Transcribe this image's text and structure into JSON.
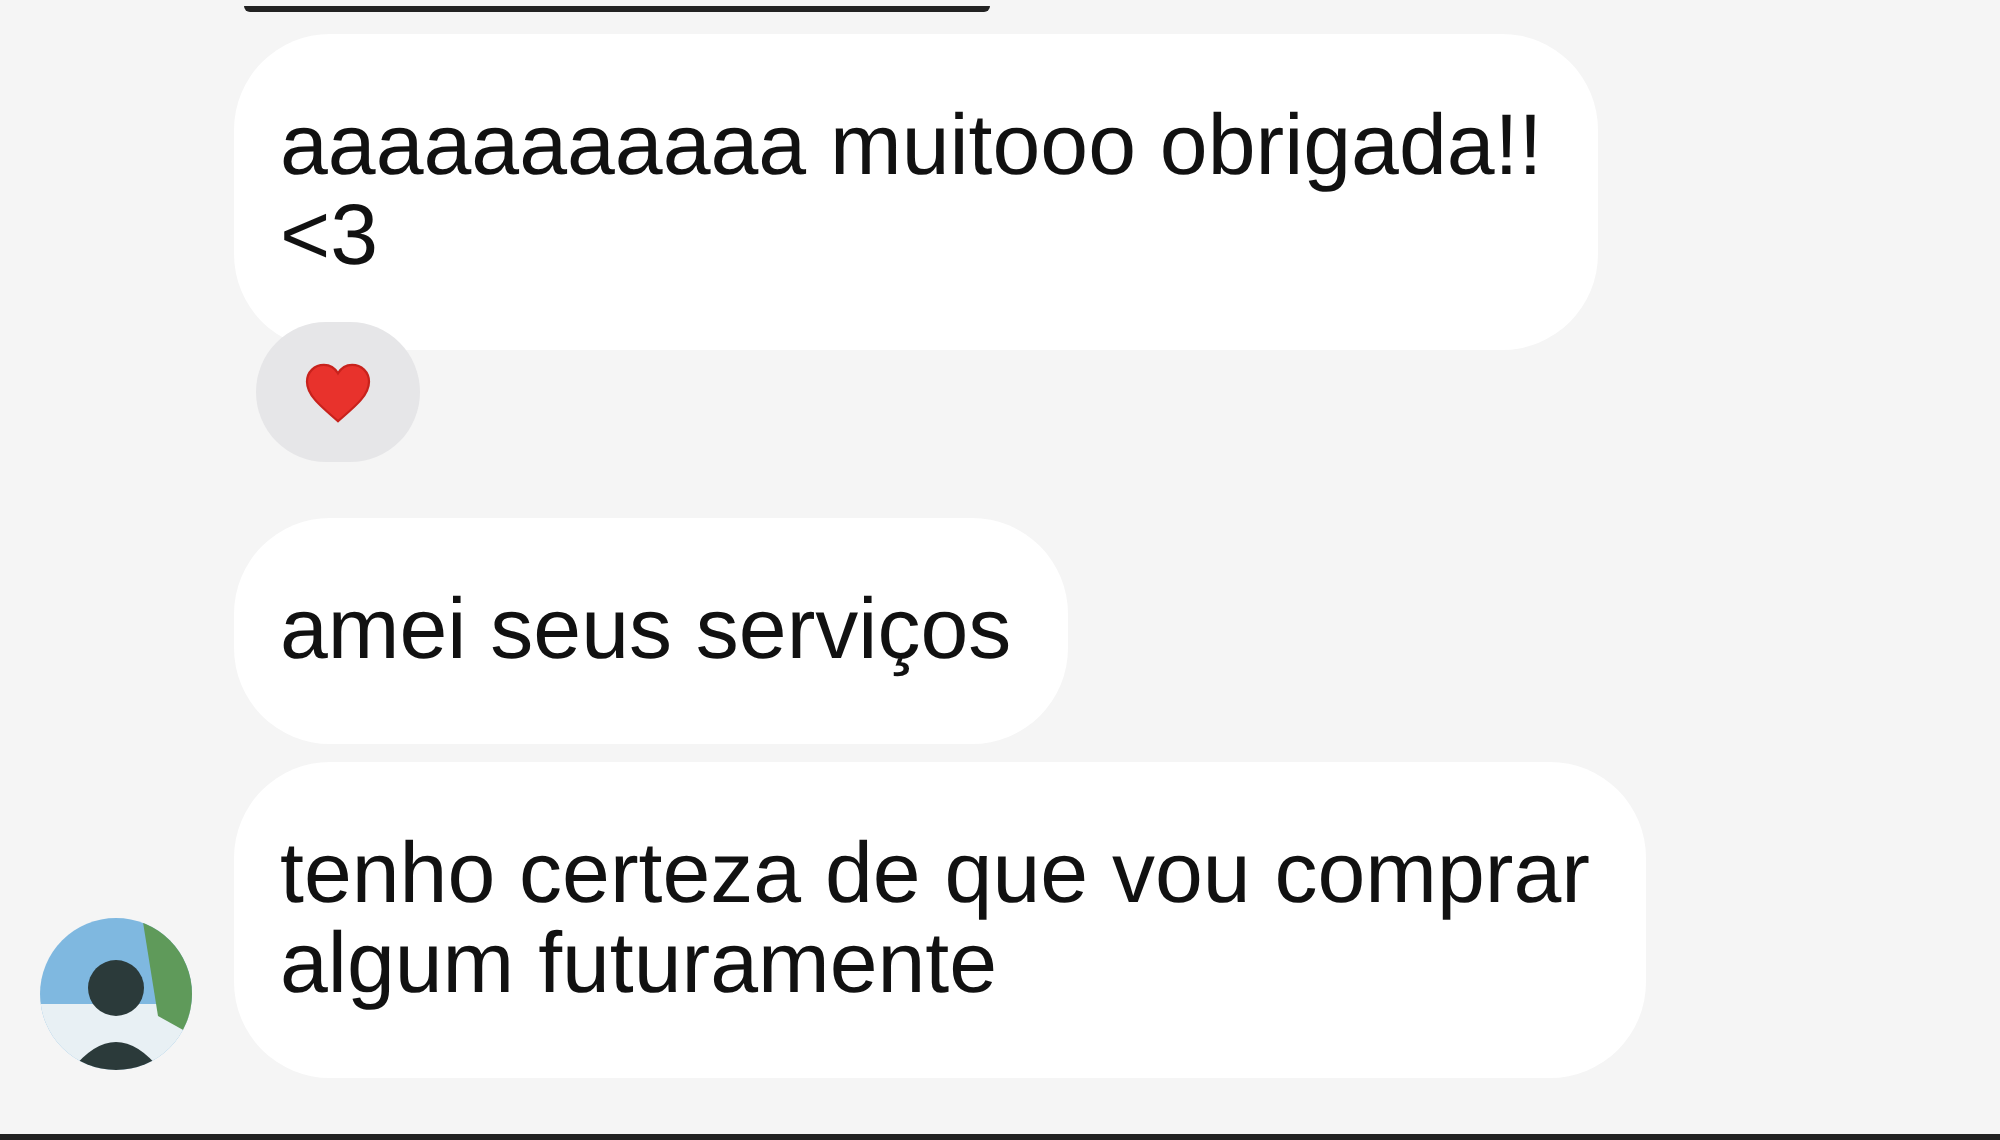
{
  "messages": [
    {
      "text": "aaaaaaaaaaa muitooo obrigada!!\n<3",
      "reaction": {
        "kind": "heart"
      }
    },
    {
      "text": "amei seus serviços"
    },
    {
      "text": "tenho certeza de que vou comprar\nalgum futuramente"
    }
  ]
}
